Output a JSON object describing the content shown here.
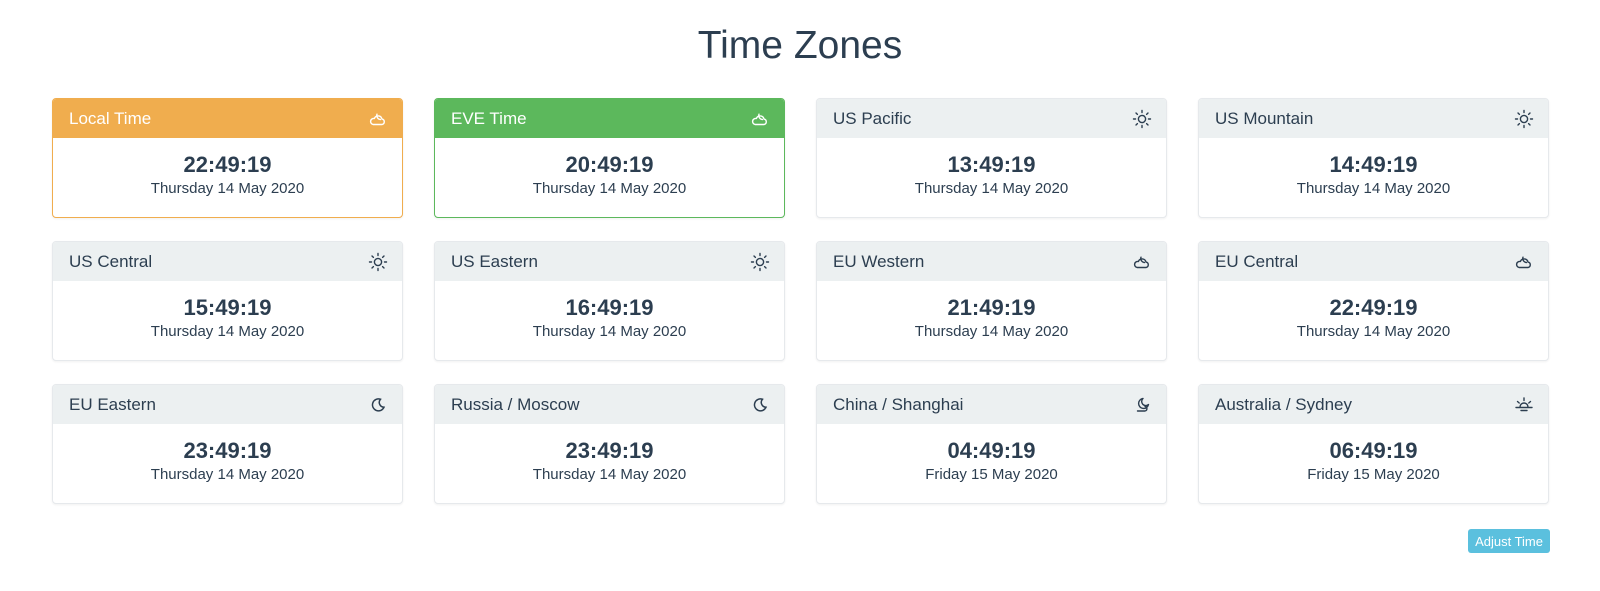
{
  "page": {
    "title": "Time Zones"
  },
  "zones": [
    {
      "name": "Local Time",
      "time": "22:49:19",
      "date": "Thursday 14 May 2020",
      "icon": "cloud-night-icon",
      "style": "local"
    },
    {
      "name": "EVE Time",
      "time": "20:49:19",
      "date": "Thursday 14 May 2020",
      "icon": "cloud-night-icon",
      "style": "eve"
    },
    {
      "name": "US Pacific",
      "time": "13:49:19",
      "date": "Thursday 14 May 2020",
      "icon": "sun-icon",
      "style": "default"
    },
    {
      "name": "US Mountain",
      "time": "14:49:19",
      "date": "Thursday 14 May 2020",
      "icon": "sun-icon",
      "style": "default"
    },
    {
      "name": "US Central",
      "time": "15:49:19",
      "date": "Thursday 14 May 2020",
      "icon": "sun-icon",
      "style": "default"
    },
    {
      "name": "US Eastern",
      "time": "16:49:19",
      "date": "Thursday 14 May 2020",
      "icon": "sun-icon",
      "style": "default"
    },
    {
      "name": "EU Western",
      "time": "21:49:19",
      "date": "Thursday 14 May 2020",
      "icon": "cloud-night-icon",
      "style": "default"
    },
    {
      "name": "EU Central",
      "time": "22:49:19",
      "date": "Thursday 14 May 2020",
      "icon": "cloud-night-icon",
      "style": "default"
    },
    {
      "name": "EU Eastern",
      "time": "23:49:19",
      "date": "Thursday 14 May 2020",
      "icon": "moon-icon",
      "style": "default"
    },
    {
      "name": "Russia / Moscow",
      "time": "23:49:19",
      "date": "Thursday 14 May 2020",
      "icon": "moon-icon",
      "style": "default"
    },
    {
      "name": "China / Shanghai",
      "time": "04:49:19",
      "date": "Friday 15 May 2020",
      "icon": "cloud-moon-icon",
      "style": "default"
    },
    {
      "name": "Australia / Sydney",
      "time": "06:49:19",
      "date": "Friday 15 May 2020",
      "icon": "sunrise-icon",
      "style": "default"
    }
  ],
  "actions": {
    "adjust_label": "Adjust Time"
  },
  "colors": {
    "text": "#2c3e50",
    "header_bg": "#ecf0f1",
    "local_accent": "#f0ad4e",
    "eve_accent": "#5cb85c",
    "button_bg": "#5bc0de"
  }
}
